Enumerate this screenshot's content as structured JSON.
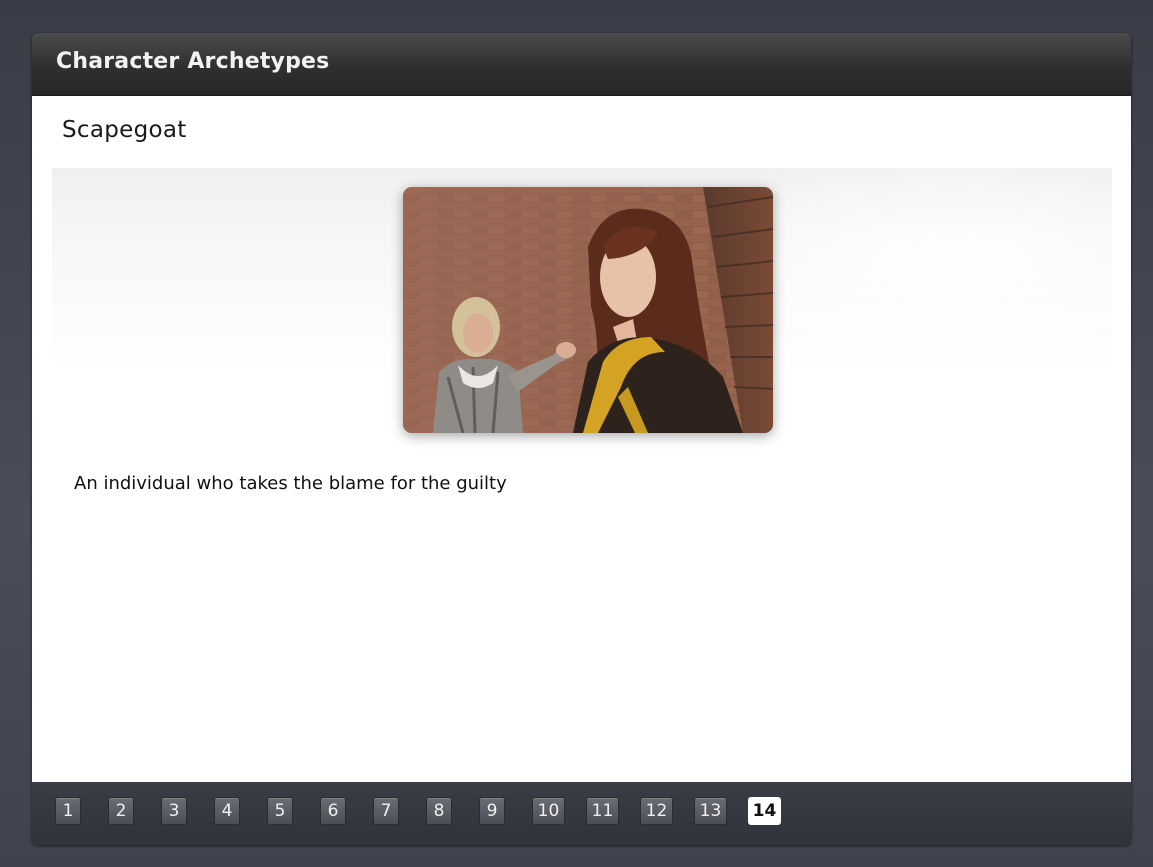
{
  "window": {
    "title": "Character Archetypes"
  },
  "slide": {
    "heading": "Scapegoat",
    "description": "An individual who takes the blame for the guilty",
    "image_icon": "photo-two-women-pointing"
  },
  "pagination": {
    "pages": [
      "1",
      "2",
      "3",
      "4",
      "5",
      "6",
      "7",
      "8",
      "9",
      "10",
      "11",
      "12",
      "13",
      "14"
    ],
    "current": "14"
  },
  "colors": {
    "title_bar": "#2f2f2f",
    "nav_bar": "#353841",
    "active_page": "#ffffff"
  }
}
